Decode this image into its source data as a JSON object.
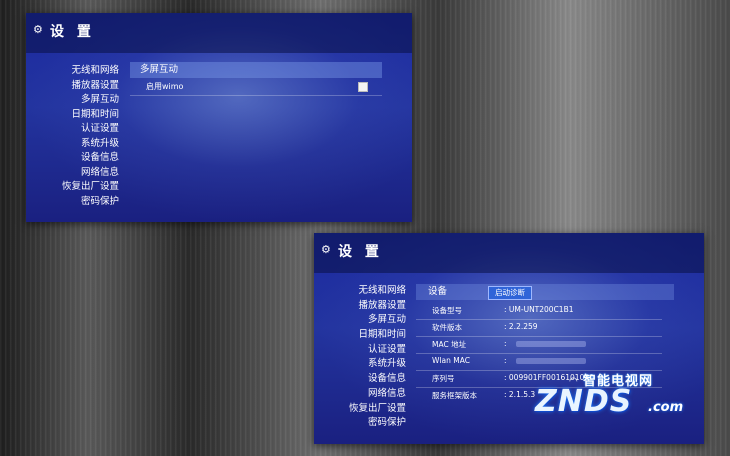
{
  "screen_top": {
    "title": "设 置",
    "menu": [
      "无线和网络",
      "播放器设置",
      "多屏互动",
      "日期和时间",
      "认证设置",
      "系统升级",
      "设备信息",
      "网络信息",
      "恢复出厂设置",
      "密码保护"
    ],
    "active_index": 2,
    "section_title": "多屏互动",
    "wimo_label": "启用wimo",
    "wimo_enabled": false
  },
  "screen_bottom": {
    "title": "设 置",
    "menu": [
      "无线和网络",
      "播放器设置",
      "多屏互动",
      "日期和时间",
      "认证设置",
      "系统升级",
      "设备信息",
      "网络信息",
      "恢复出厂设置",
      "密码保护"
    ],
    "active_index": 6,
    "section_title": "设备",
    "diag_button": "启动诊断",
    "rows": [
      {
        "label": "设备型号",
        "value": ": UM-UNT200C1B1"
      },
      {
        "label": "软件版本",
        "value": ": 2.2.259"
      },
      {
        "label": "MAC 地址",
        "value": ":"
      },
      {
        "label": "Wlan MAC",
        "value": ":"
      },
      {
        "label": "序列号",
        "value": ": 009901FF0016101000"
      },
      {
        "label": "服务框架版本",
        "value": ": 2.1.5.3"
      }
    ]
  },
  "watermark": {
    "top_text": "智能电视网",
    "brand": "ZNDS",
    "suffix": ".com"
  },
  "icons": {
    "settings": "gear-icon",
    "signal": "signal-icon"
  }
}
